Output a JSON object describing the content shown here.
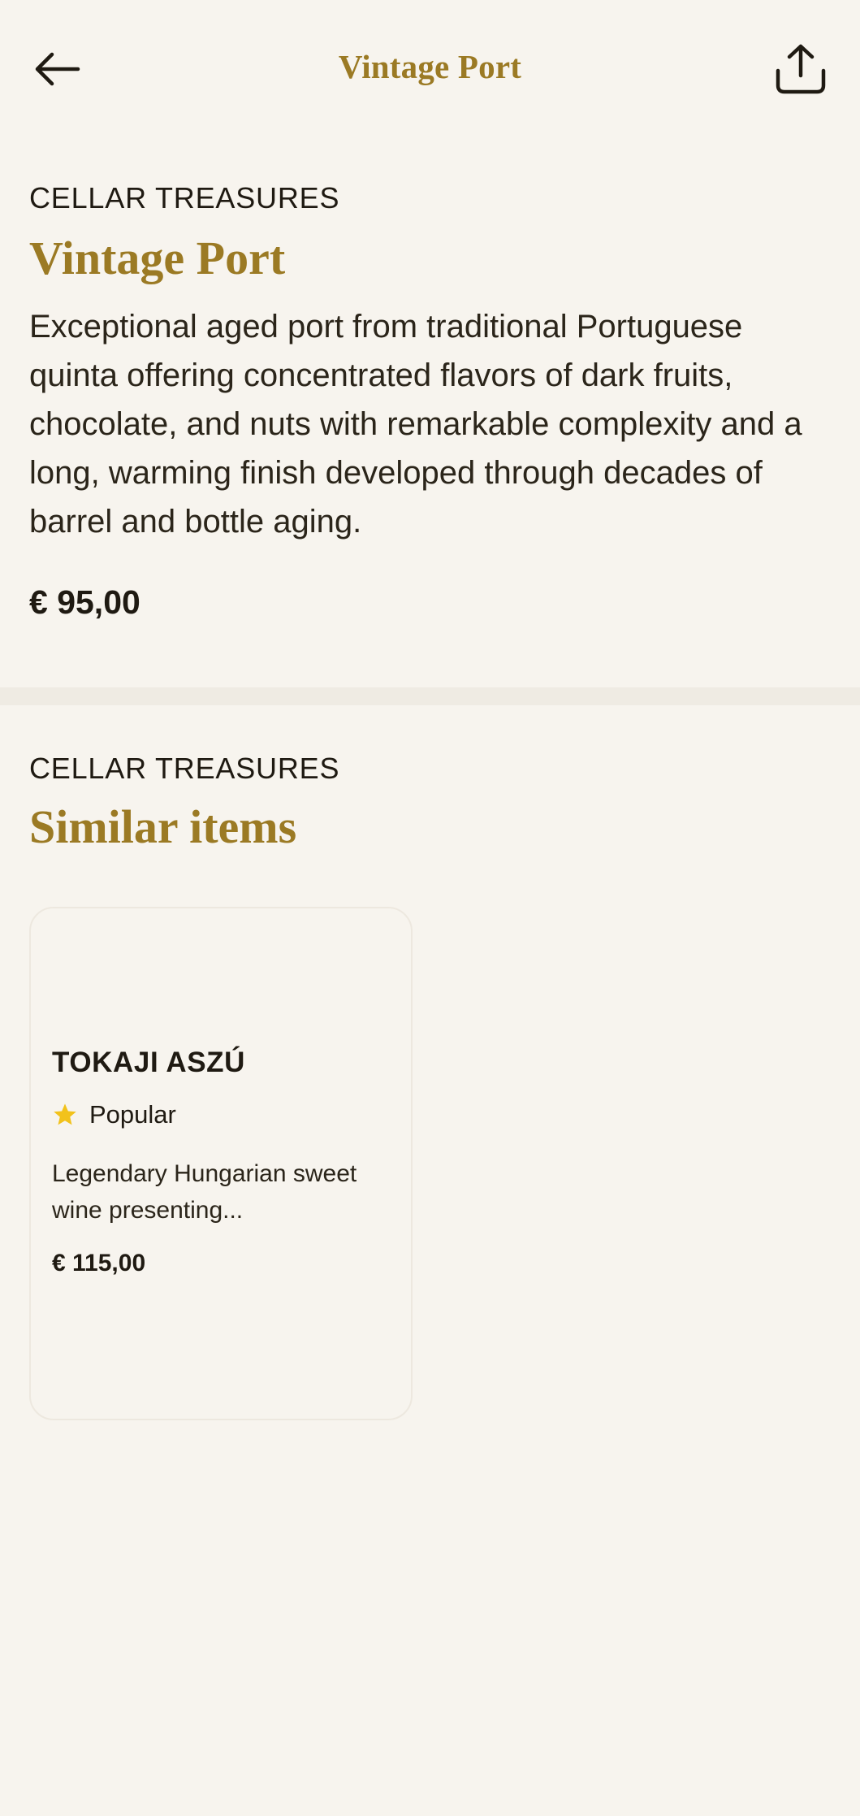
{
  "header": {
    "title": "Vintage Port",
    "back_icon": "arrow-left-icon",
    "share_icon": "share-icon"
  },
  "product": {
    "category": "CELLAR TREASURES",
    "name": "Vintage Port",
    "description": "Exceptional aged port from traditional Portuguese quinta offering concentrated flavors of dark fruits, chocolate, and nuts with remarkable complexity and a long, warming finish developed through decades of barrel and bottle aging.",
    "price": "€ 95,00"
  },
  "similar": {
    "category": "CELLAR TREASURES",
    "title": "Similar items",
    "items": [
      {
        "name": "TOKAJI ASZÚ",
        "badge": "Popular",
        "badge_icon": "star-icon",
        "description": "Legendary Hungarian sweet wine presenting...",
        "price": "€ 115,00"
      }
    ]
  },
  "colors": {
    "background": "#f7f4ee",
    "accent_gold": "#9b7a24",
    "text": "#1f1a12",
    "star": "#f2c21b",
    "divider": "#efebe3"
  }
}
